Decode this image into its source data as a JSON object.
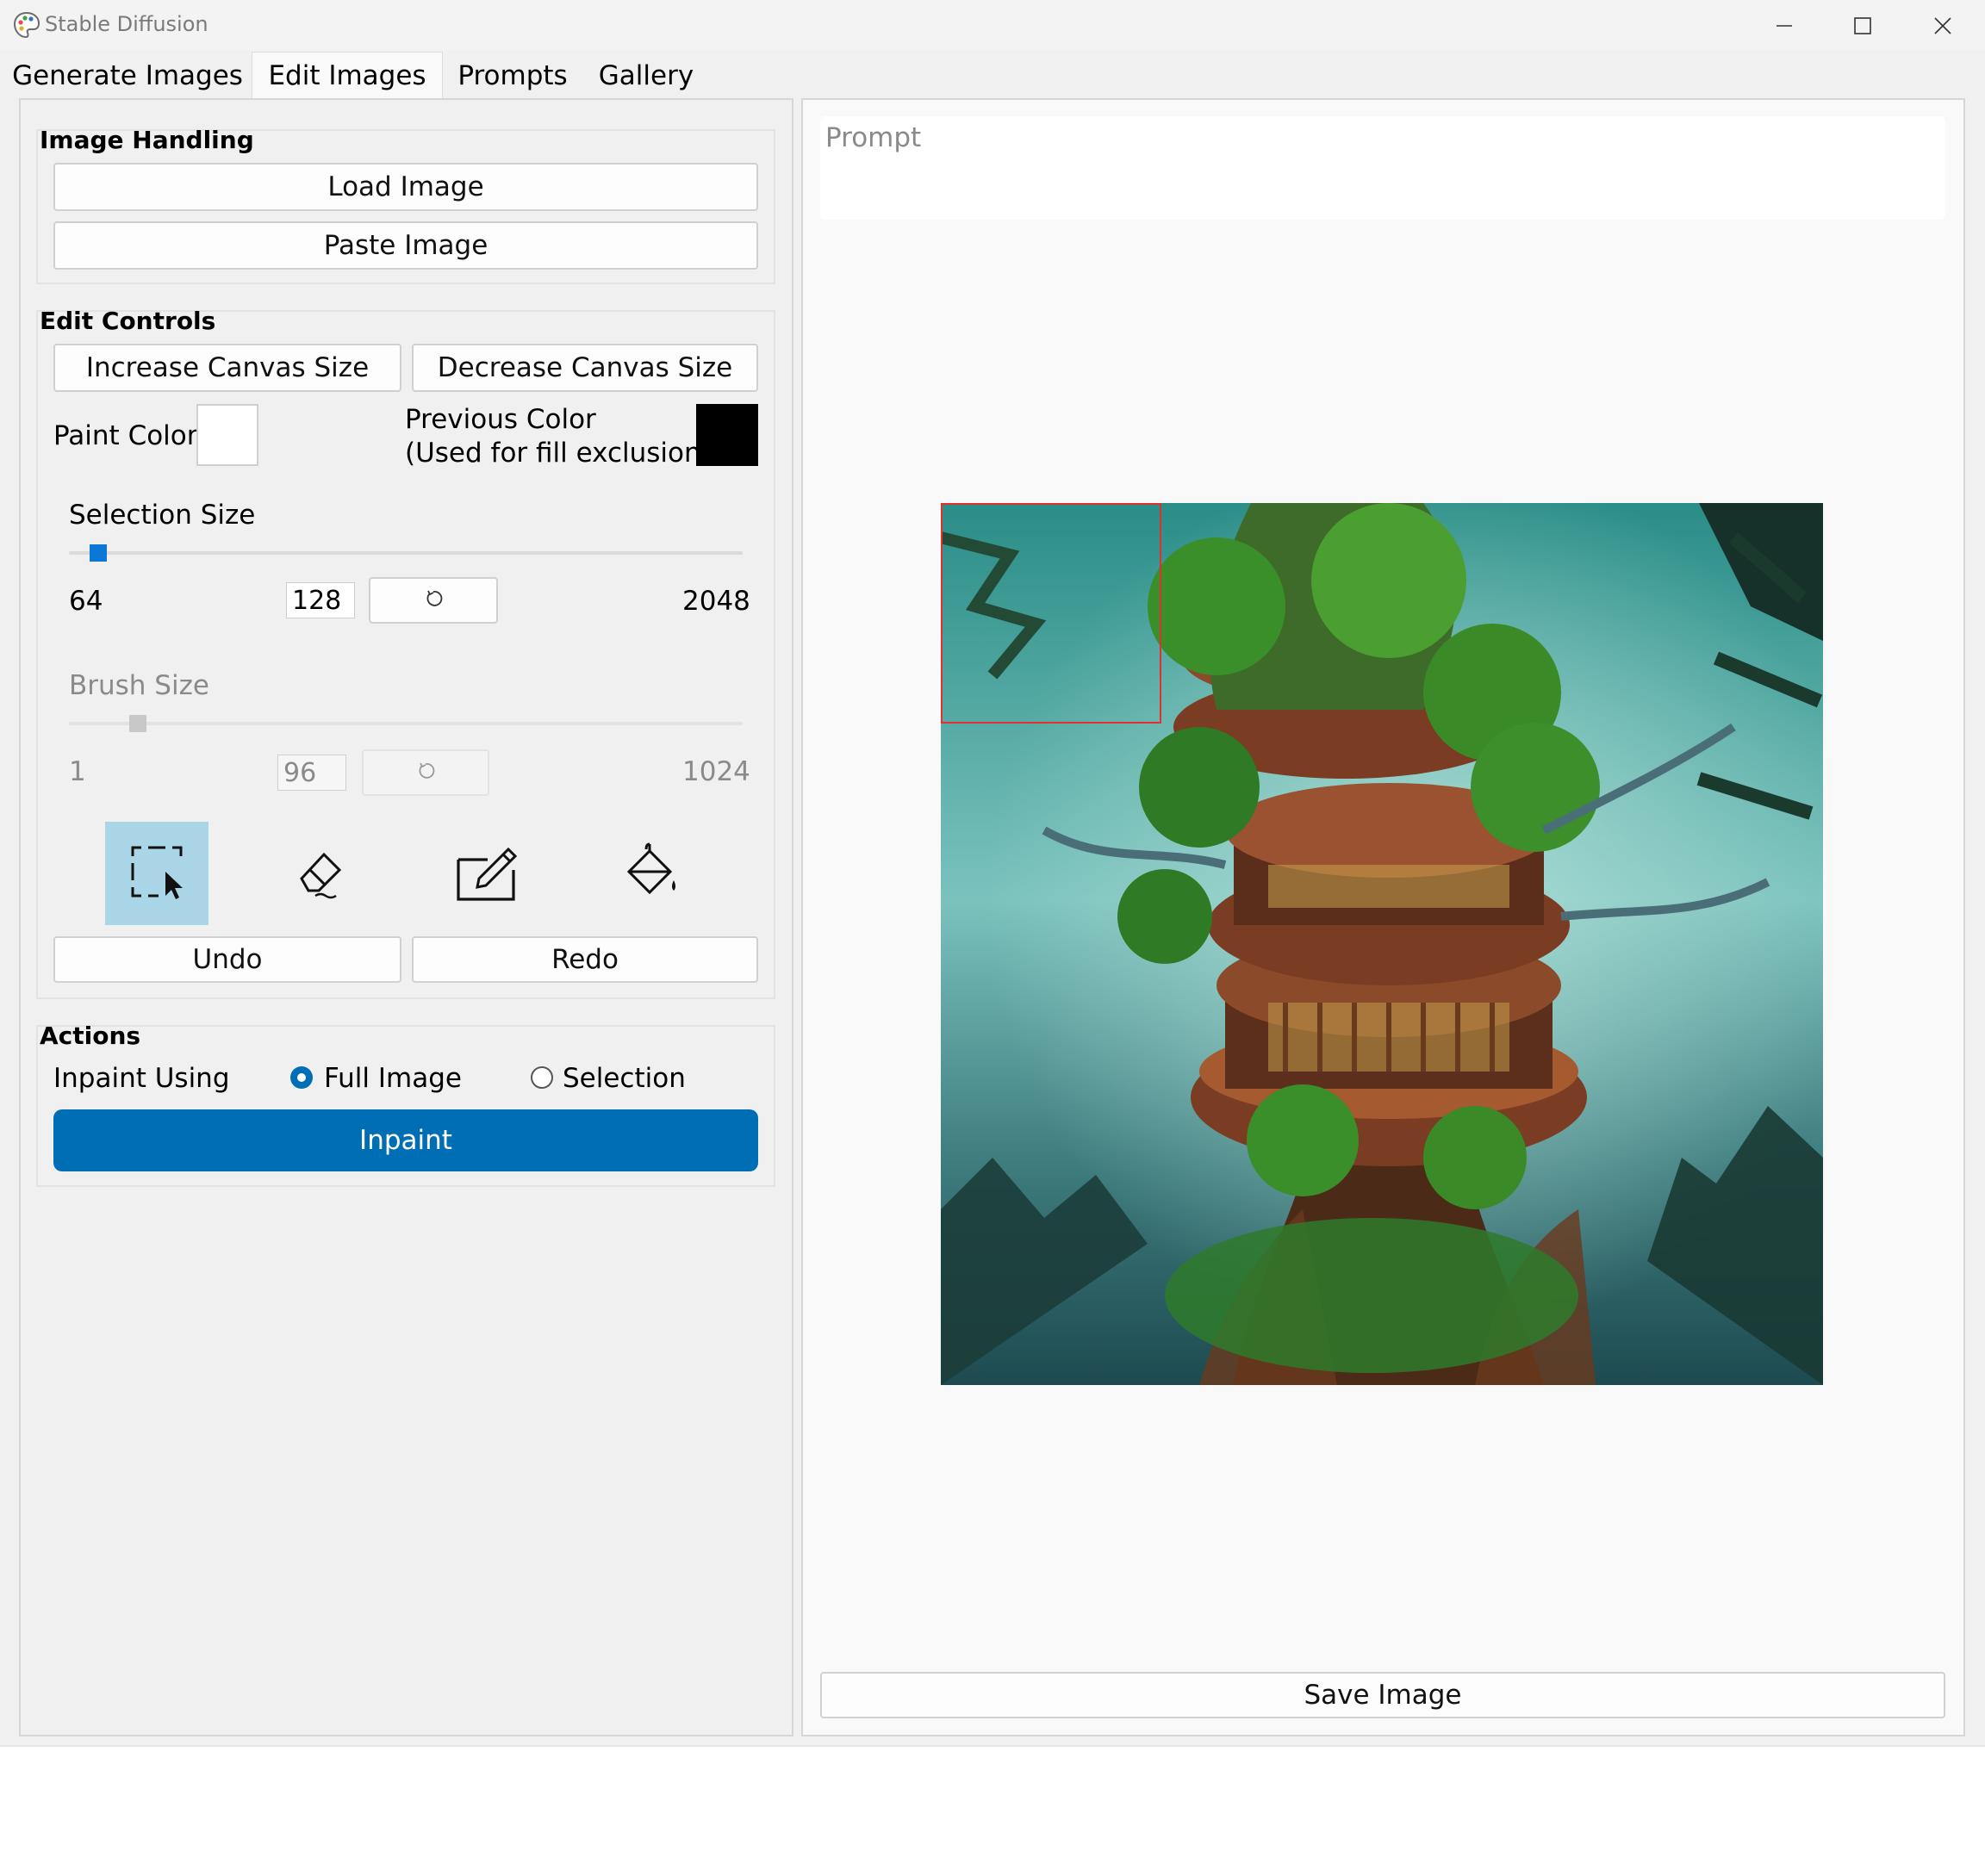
{
  "window": {
    "title": "Stable Diffusion",
    "icon": "palette-icon",
    "controls": [
      "minimize-icon",
      "maximize-icon",
      "close-icon"
    ]
  },
  "tabs": [
    {
      "label": "Generate Images",
      "active": false
    },
    {
      "label": "Edit Images",
      "active": true
    },
    {
      "label": "Prompts",
      "active": false
    },
    {
      "label": "Gallery",
      "active": false
    }
  ],
  "image_handling": {
    "title": "Image Handling",
    "load_label": "Load Image",
    "paste_label": "Paste Image"
  },
  "edit_controls": {
    "title": "Edit Controls",
    "increase_label": "Increase Canvas Size",
    "decrease_label": "Decrease Canvas Size",
    "paint_color_label": "Paint Color",
    "paint_color": "#ffffff",
    "previous_color_label_line1": "Previous Color",
    "previous_color_label_line2": "(Used for fill exclusion)",
    "previous_color": "#000000",
    "selection_size": {
      "label": "Selection Size",
      "min": "64",
      "value": "128",
      "max": "2048",
      "reset_icon": "reset-icon"
    },
    "brush_size": {
      "label": "Brush Size",
      "min": "1",
      "value": "96",
      "max": "1024",
      "reset_icon": "reset-icon",
      "enabled": false
    },
    "tools": [
      {
        "name": "selection-tool",
        "icon": "selection-cursor-icon",
        "active": true
      },
      {
        "name": "eraser-tool",
        "icon": "eraser-icon",
        "active": false
      },
      {
        "name": "pencil-tool",
        "icon": "pencil-icon",
        "active": false
      },
      {
        "name": "fill-tool",
        "icon": "paint-bucket-icon",
        "active": false
      }
    ],
    "undo_label": "Undo",
    "redo_label": "Redo"
  },
  "actions": {
    "title": "Actions",
    "inpaint_using_label": "Inpaint Using",
    "options": [
      {
        "label": "Full Image",
        "selected": true
      },
      {
        "label": "Selection",
        "selected": false
      }
    ],
    "inpaint_label": "Inpaint"
  },
  "canvas": {
    "prompt_placeholder": "Prompt",
    "image_subject": "fantasy tree house tower in forest",
    "selection_color": "#e03030",
    "save_label": "Save Image"
  },
  "colors": {
    "accent": "#006eb5",
    "active_tool": "#a9d5e7",
    "slider_thumb": "#0a78d4"
  }
}
